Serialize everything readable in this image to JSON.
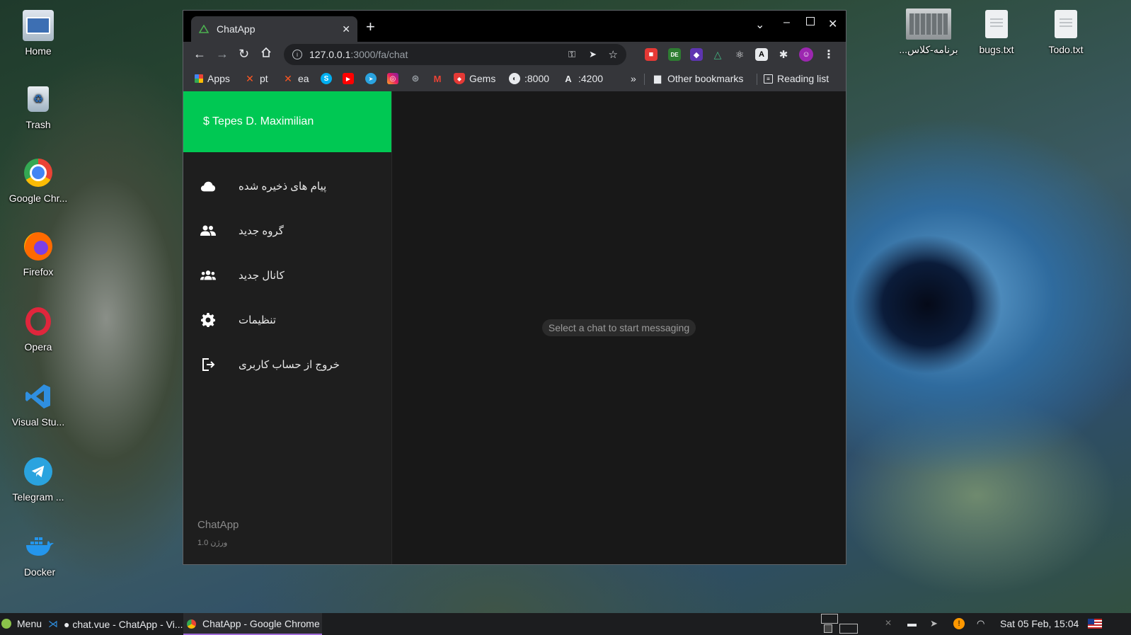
{
  "desktop": {
    "left_icons": [
      {
        "label": "Home",
        "icon": "home-folder-icon"
      },
      {
        "label": "Trash",
        "icon": "trash-icon"
      },
      {
        "label": "Google Chr...",
        "icon": "chrome-icon"
      },
      {
        "label": "Firefox",
        "icon": "firefox-icon"
      },
      {
        "label": "Opera",
        "icon": "opera-icon"
      },
      {
        "label": "Visual Stu...",
        "icon": "vscode-icon"
      },
      {
        "label": "Telegram ...",
        "icon": "telegram-icon"
      },
      {
        "label": "Docker",
        "icon": "docker-icon"
      }
    ],
    "right_icons": [
      {
        "label": "...برنامه-کلاس",
        "icon": "image-file-icon"
      },
      {
        "label": "bugs.txt",
        "icon": "text-file-icon"
      },
      {
        "label": "Todo.txt",
        "icon": "text-file-icon"
      }
    ]
  },
  "browser": {
    "tab_title": "ChatApp",
    "url_host": "127.0.0.1",
    "url_rest": ":3000/fa/chat",
    "bookmarks": {
      "apps": "Apps",
      "pt": "pt",
      "ea": "ea",
      "gems": "Gems",
      "port8000": ":8000",
      "port4200": ":4200",
      "more": "»",
      "other": "Other bookmarks",
      "reading": "Reading list"
    }
  },
  "app": {
    "header_user": "$ Tepes D. Maximilian",
    "menu": [
      {
        "label": "پیام های ذخیره شده",
        "icon": "cloud-icon"
      },
      {
        "label": "گروه جدید",
        "icon": "group-icon"
      },
      {
        "label": "کانال جدید",
        "icon": "channel-group-icon"
      },
      {
        "label": "تنظیمات",
        "icon": "gear-icon"
      },
      {
        "label": "خروج از حساب کاربری",
        "icon": "logout-icon"
      }
    ],
    "footer_name": "ChatApp",
    "footer_version": "ورژن 1.0",
    "empty_state": "Select a chat to start messaging"
  },
  "taskbar": {
    "menu_label": "Menu",
    "vscode_window": "● chat.vue - ChatApp - Vi...",
    "chrome_window": "ChatApp - Google Chrome",
    "clock": "Sat 05 Feb, 15:04"
  },
  "colors": {
    "accent_green": "#00c853",
    "sidebar_bg": "#1e1e1e",
    "main_bg": "#181818"
  }
}
